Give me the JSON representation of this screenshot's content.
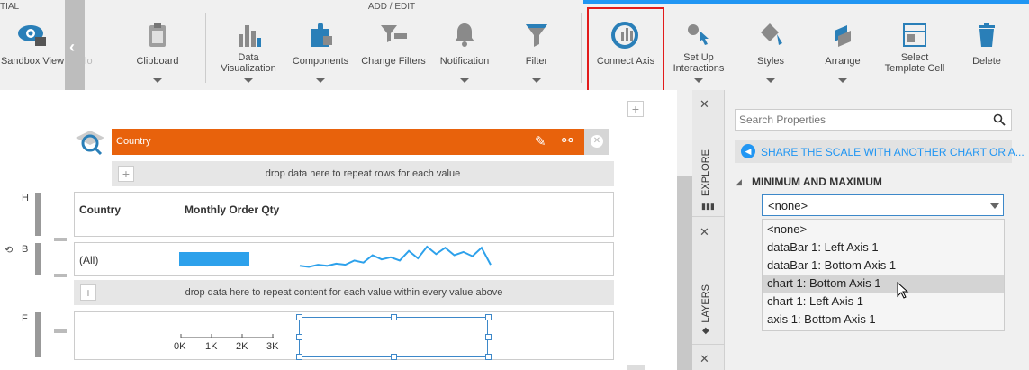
{
  "ribbon": {
    "left_group_fragment": "TIAL",
    "group_title": "ADD / EDIT",
    "sandbox_label": "Sandbox View",
    "undo_fragment": "lo",
    "buttons": [
      {
        "label": "Clipboard",
        "icon": "clipboard-icon"
      },
      {
        "label": "Data\nVisualization",
        "icon": "bar-chart-icon"
      },
      {
        "label": "Components",
        "icon": "puzzle-icon"
      },
      {
        "label": "Change Filters",
        "icon": "filter-change-icon"
      },
      {
        "label": "Notification",
        "icon": "bell-icon"
      },
      {
        "label": "Filter",
        "icon": "filter-icon"
      },
      {
        "label": "Connect Axis",
        "icon": "connect-axis-icon"
      },
      {
        "label": "Set Up\nInteractions",
        "icon": "interactions-icon"
      },
      {
        "label": "Styles",
        "icon": "paint-bucket-icon"
      },
      {
        "label": "Arrange",
        "icon": "arrange-icon"
      },
      {
        "label": "Select\nTemplate Cell",
        "icon": "template-cell-icon"
      },
      {
        "label": "Delete",
        "icon": "trash-icon"
      }
    ],
    "highlight_color": "#e21b1b",
    "accent_color": "#2196f3"
  },
  "canvas": {
    "filter_title": "Country",
    "filter_color": "#e8620c",
    "drop_rows_text": "drop data here to repeat rows for each value",
    "drop_content_text": "drop data here to repeat content for each value within every value above",
    "row_labels": {
      "header": "H",
      "body": "B",
      "footer": "F"
    },
    "table": {
      "col1_header": "Country",
      "col2_header": "Monthly Order Qty",
      "row_value": "(All)",
      "bar_fraction": 0.5,
      "sparkline": [
        4,
        3,
        5,
        4,
        6,
        5,
        9,
        7,
        14,
        10,
        12,
        9,
        18,
        11,
        22,
        15,
        21,
        14,
        17,
        13,
        21,
        5
      ]
    },
    "axis_ticks": [
      "0K",
      "1K",
      "2K",
      "3K"
    ]
  },
  "panel": {
    "tab_explore": "EXPLORE",
    "tab_layers": "LAYERS",
    "search_placeholder": "Search Properties",
    "share_scale_text": "SHARE THE SCALE WITH ANOTHER CHART OR A...",
    "section_title": "MINIMUM AND MAXIMUM",
    "dropdown_value": "<none>",
    "options": [
      "<none>",
      "dataBar 1: Left Axis 1",
      "dataBar 1: Bottom Axis 1",
      "chart 1: Bottom Axis 1",
      "chart 1: Left Axis 1",
      "axis 1: Bottom Axis 1"
    ],
    "hovered_option_index": 3
  }
}
